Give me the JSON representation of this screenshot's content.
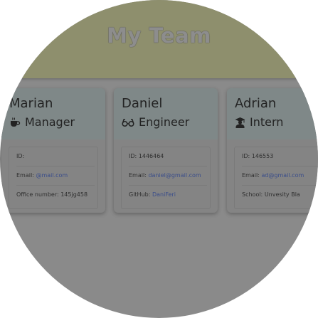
{
  "header": {
    "title": "My Team"
  },
  "cards": [
    {
      "name": "Marian",
      "role": "Manager",
      "id_label": "ID:",
      "id_value": "",
      "email_label": "Email:",
      "email_value": "@mail.com",
      "extra_label": "Office number:",
      "extra_value": "145jg458"
    },
    {
      "name": "Daniel",
      "role": "Engineer",
      "id_label": "ID:",
      "id_value": "1446464",
      "email_label": "Email:",
      "email_value": "daniel@gmail.com",
      "extra_label": "GitHub:",
      "extra_value": "DaniFeri"
    },
    {
      "name": "Adrian",
      "role": "Intern",
      "id_label": "ID:",
      "id_value": "146553",
      "email_label": "Email:",
      "email_value": "ad@gmail.com",
      "extra_label": "School:",
      "extra_value": "Unvesity Bla"
    }
  ],
  "icons": {
    "manager": "coffee-cup-icon",
    "engineer": "glasses-icon",
    "intern": "graduate-icon"
  },
  "colors": {
    "header_bg": "#8e8f6d",
    "card_head_bg": "#7f8888",
    "link": "#3a4d8a"
  }
}
